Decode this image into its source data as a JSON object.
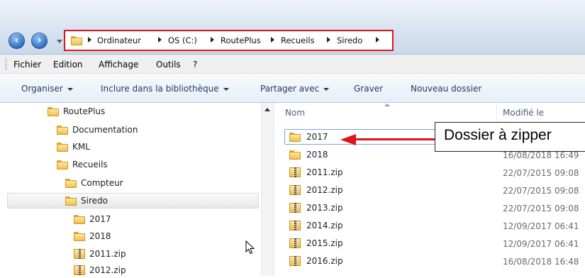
{
  "navigation": {
    "back_icon": "back-arrow-icon",
    "forward_icon": "forward-arrow-icon",
    "breadcrumb": [
      "Ordinateur",
      "OS (C:)",
      "RoutePlus",
      "Recueils",
      "Siredo"
    ]
  },
  "menubar": [
    "Fichier",
    "Edition",
    "Affichage",
    "Outils",
    "?"
  ],
  "toolbar": {
    "organiser": "Organiser",
    "inclure": "Inclure dans la bibliothèque",
    "partager": "Partager avec",
    "graver": "Graver",
    "nouveau_dossier": "Nouveau dossier"
  },
  "tree": [
    {
      "label": "RoutePlus",
      "icon": "folder"
    },
    {
      "label": "Documentation",
      "icon": "folder"
    },
    {
      "label": "KML",
      "icon": "folder"
    },
    {
      "label": "Recueils",
      "icon": "folder"
    },
    {
      "label": "Compteur",
      "icon": "folder"
    },
    {
      "label": "Siredo",
      "icon": "folder",
      "selected": true
    },
    {
      "label": "2017",
      "icon": "folder"
    },
    {
      "label": "2018",
      "icon": "folder"
    },
    {
      "label": "2011.zip",
      "icon": "zip"
    },
    {
      "label": "2012.zip",
      "icon": "zip"
    }
  ],
  "filelist": {
    "columns": {
      "name": "Nom",
      "modified": "Modifié le"
    },
    "files": [
      {
        "name": "2017",
        "icon": "folder",
        "date": ""
      },
      {
        "name": "2018",
        "icon": "folder",
        "date": "16/08/2018 16:49"
      },
      {
        "name": "2011.zip",
        "icon": "zip",
        "date": "22/07/2015 09:08"
      },
      {
        "name": "2012.zip",
        "icon": "zip",
        "date": "22/07/2015 09:08"
      },
      {
        "name": "2013.zip",
        "icon": "zip",
        "date": "22/07/2015 09:08"
      },
      {
        "name": "2014.zip",
        "icon": "zip",
        "date": "12/09/2017 06:41"
      },
      {
        "name": "2015.zip",
        "icon": "zip",
        "date": "12/09/2017 06:41"
      },
      {
        "name": "2016.zip",
        "icon": "zip",
        "date": "16/08/2018 16:48"
      }
    ]
  },
  "annotation": {
    "text": "Dossier à zipper",
    "color": "#e0141b"
  }
}
